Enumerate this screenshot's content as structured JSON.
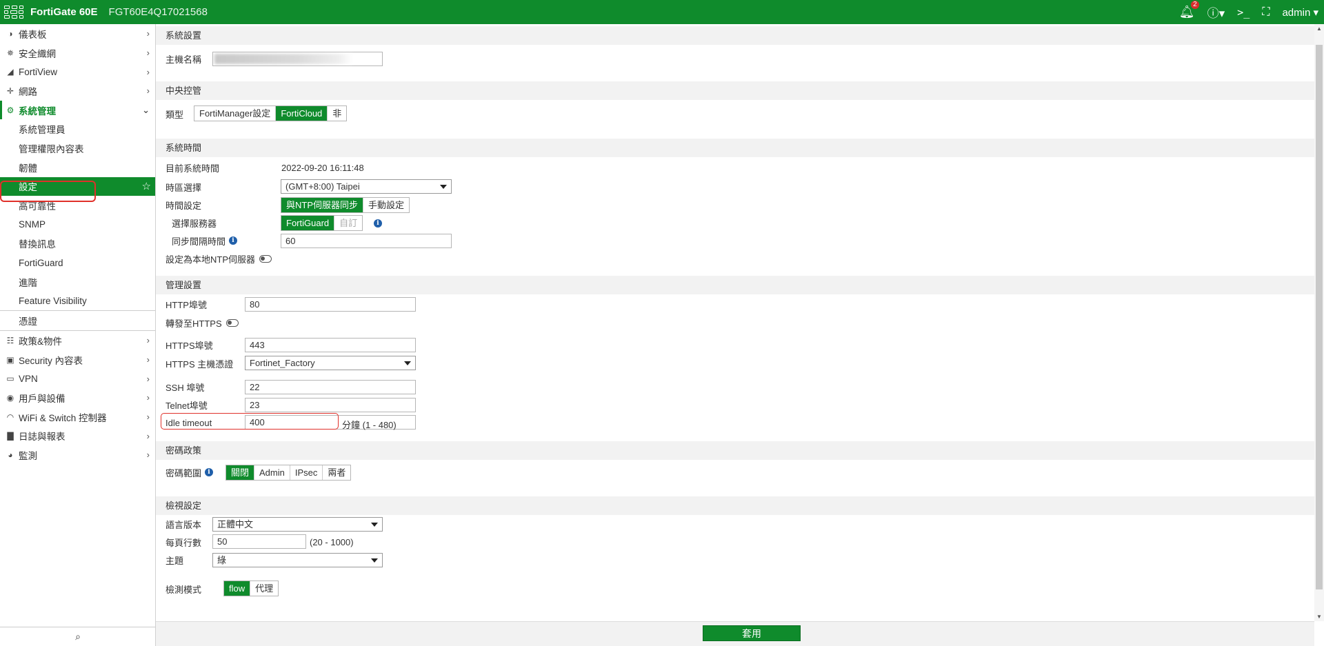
{
  "topbar": {
    "brand": "FortiGate 60E",
    "serial": "FGT60E4Q17021568",
    "notification_count": "2",
    "user": "admin"
  },
  "sidebar": {
    "items": [
      {
        "label": "儀表板",
        "icon": "dashboard-icon"
      },
      {
        "label": "安全織網",
        "icon": "fabric-icon"
      },
      {
        "label": "FortiView",
        "icon": "chart-icon"
      },
      {
        "label": "網路",
        "icon": "network-icon"
      },
      {
        "label": "系統管理",
        "icon": "gear-icon"
      }
    ],
    "sub_items": [
      "系統管理員",
      "管理權限內容表",
      "韌體",
      "設定",
      "高可靠性",
      "SNMP",
      "替換訊息",
      "FortiGuard",
      "進階",
      "Feature Visibility"
    ],
    "items_after": [
      {
        "label": "憑證",
        "icon": ""
      },
      {
        "label": "政策&物件",
        "icon": "policy-icon"
      },
      {
        "label": "Security 內容表",
        "icon": "lock-icon"
      },
      {
        "label": "VPN",
        "icon": "laptop-icon"
      },
      {
        "label": "用戶與設備",
        "icon": "user-icon"
      },
      {
        "label": "WiFi & Switch 控制器",
        "icon": "wifi-icon"
      },
      {
        "label": "日誌與報表",
        "icon": "report-icon"
      },
      {
        "label": "監測",
        "icon": "monitor-icon"
      }
    ]
  },
  "main": {
    "system_settings": {
      "header": "系統設置",
      "hostname_label": "主機名稱"
    },
    "central_mgmt": {
      "header": "中央控管",
      "type_label": "類型",
      "options": [
        "FortiManager設定",
        "FortiCloud",
        "非"
      ],
      "selected": "FortiCloud"
    },
    "system_time": {
      "header": "系統時間",
      "current_label": "目前系統時間",
      "current_value": "2022-09-20 16:11:48",
      "timezone_label": "時區選擇",
      "timezone_value": "(GMT+8:00) Taipei",
      "time_setting_label": "時間設定",
      "time_options": [
        "與NTP伺服器同步",
        "手動設定"
      ],
      "server_label": "選擇服務器",
      "server_options": [
        "FortiGuard",
        "自訂"
      ],
      "sync_interval_label": "同步間隔時間",
      "sync_interval_value": "60",
      "local_ntp_label": "設定為本地NTP伺服器"
    },
    "admin_settings": {
      "header": "管理設置",
      "http_port_label": "HTTP埠號",
      "http_port_value": "80",
      "redirect_label": "轉發至HTTPS",
      "https_port_label": "HTTPS埠號",
      "https_port_value": "443",
      "https_cert_label": "HTTPS 主機憑證",
      "https_cert_value": "Fortinet_Factory",
      "ssh_port_label": "SSH 埠號",
      "ssh_port_value": "22",
      "telnet_port_label": "Telnet埠號",
      "telnet_port_value": "23",
      "idle_label": "Idle timeout",
      "idle_value": "400",
      "idle_hint": "分鐘 (1 - 480)"
    },
    "password_policy": {
      "header": "密碼政策",
      "scope_label": "密碼範圍",
      "options": [
        "關閉",
        "Admin",
        "IPsec",
        "兩者"
      ]
    },
    "view_settings": {
      "header": "檢視設定",
      "language_label": "語言版本",
      "language_value": "正體中文",
      "lines_label": "每頁行數",
      "lines_value": "50",
      "lines_hint": "(20 - 1000)",
      "theme_label": "主題",
      "theme_value": "綠",
      "inspect_label": "檢測模式",
      "inspect_options": [
        "flow",
        "代理"
      ]
    }
  },
  "footer": {
    "apply_label": "套用"
  },
  "colors": {
    "brand_green": "#0f8b2c",
    "highlight_red": "#e0302a"
  }
}
